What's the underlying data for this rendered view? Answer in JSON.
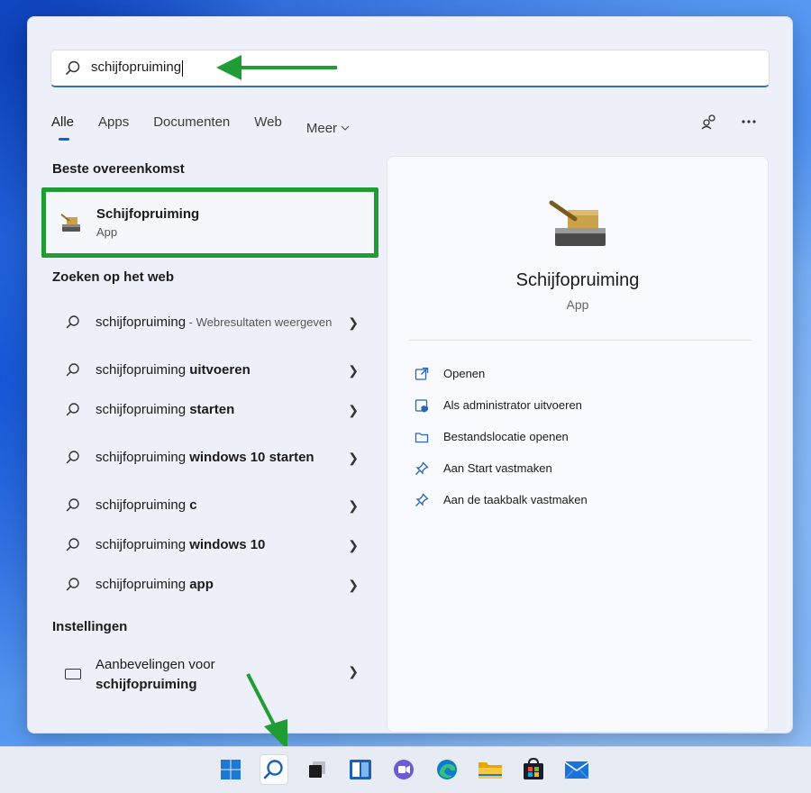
{
  "search": {
    "value": "schijfopruiming"
  },
  "tabs": [
    {
      "label": "Alle",
      "active": true
    },
    {
      "label": "Apps"
    },
    {
      "label": "Documenten"
    },
    {
      "label": "Web"
    },
    {
      "label": "Meer"
    }
  ],
  "best_match": {
    "section_title": "Beste overeenkomst",
    "name": "Schijfopruiming",
    "type": "App"
  },
  "web": {
    "section_title": "Zoeken op het web",
    "items": [
      {
        "query": "schijfopruiming",
        "suffix": " - Webresultaten weergeven",
        "bold": ""
      },
      {
        "query": "schijfopruiming ",
        "bold": "uitvoeren"
      },
      {
        "query": "schijfopruiming ",
        "bold": "starten"
      },
      {
        "query": "schijfopruiming ",
        "bold": "windows 10 starten"
      },
      {
        "query": "schijfopruiming ",
        "bold": "c"
      },
      {
        "query": "schijfopruiming ",
        "bold": "windows 10"
      },
      {
        "query": "schijfopruiming ",
        "bold": "app"
      }
    ]
  },
  "settings": {
    "section_title": "Instellingen",
    "item_prefix": "Aanbevelingen voor",
    "item_bold": "schijfopruiming"
  },
  "detail": {
    "name": "Schijfopruiming",
    "type": "App",
    "actions": [
      {
        "label": "Openen",
        "icon": "open-icon"
      },
      {
        "label": "Als administrator uitvoeren",
        "icon": "admin-shield-icon"
      },
      {
        "label": "Bestandslocatie openen",
        "icon": "folder-icon"
      },
      {
        "label": "Aan Start vastmaken",
        "icon": "pin-icon"
      },
      {
        "label": "Aan de taakbalk vastmaken",
        "icon": "pin-icon"
      }
    ]
  },
  "taskbar": {
    "icons": [
      "start-icon",
      "search-icon",
      "task-view-icon",
      "widgets-icon",
      "teams-chat-icon",
      "edge-icon",
      "file-explorer-icon",
      "store-icon",
      "mail-icon"
    ]
  },
  "colors": {
    "accent": "#0c5fd0",
    "highlight": "#1f9c33"
  }
}
